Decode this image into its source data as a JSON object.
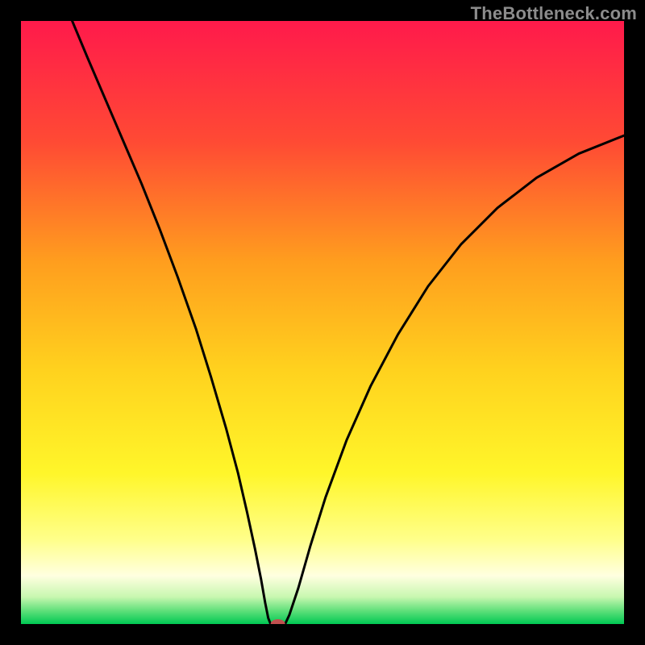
{
  "watermark": "TheBottleneck.com",
  "chart_data": {
    "type": "line",
    "title": "",
    "xlabel": "",
    "ylabel": "",
    "xlim": [
      0,
      1
    ],
    "ylim": [
      0,
      1
    ],
    "background_gradient": {
      "stops": [
        {
          "offset": 0.0,
          "color": "#ff1a4b"
        },
        {
          "offset": 0.2,
          "color": "#ff4a34"
        },
        {
          "offset": 0.4,
          "color": "#ff9e1e"
        },
        {
          "offset": 0.58,
          "color": "#ffd21e"
        },
        {
          "offset": 0.75,
          "color": "#fff62a"
        },
        {
          "offset": 0.86,
          "color": "#ffff8a"
        },
        {
          "offset": 0.92,
          "color": "#ffffe0"
        },
        {
          "offset": 0.955,
          "color": "#c8f7b0"
        },
        {
          "offset": 0.978,
          "color": "#5fe07a"
        },
        {
          "offset": 1.0,
          "color": "#00c853"
        }
      ]
    },
    "curve_points": [
      {
        "x": 0.085,
        "y": 1.0
      },
      {
        "x": 0.11,
        "y": 0.94
      },
      {
        "x": 0.14,
        "y": 0.87
      },
      {
        "x": 0.17,
        "y": 0.8
      },
      {
        "x": 0.2,
        "y": 0.73
      },
      {
        "x": 0.23,
        "y": 0.655
      },
      {
        "x": 0.26,
        "y": 0.575
      },
      {
        "x": 0.29,
        "y": 0.49
      },
      {
        "x": 0.315,
        "y": 0.41
      },
      {
        "x": 0.34,
        "y": 0.325
      },
      {
        "x": 0.36,
        "y": 0.25
      },
      {
        "x": 0.375,
        "y": 0.185
      },
      {
        "x": 0.388,
        "y": 0.125
      },
      {
        "x": 0.398,
        "y": 0.075
      },
      {
        "x": 0.405,
        "y": 0.035
      },
      {
        "x": 0.41,
        "y": 0.01
      },
      {
        "x": 0.414,
        "y": 0.0
      },
      {
        "x": 0.438,
        "y": 0.0
      },
      {
        "x": 0.445,
        "y": 0.015
      },
      {
        "x": 0.46,
        "y": 0.06
      },
      {
        "x": 0.48,
        "y": 0.13
      },
      {
        "x": 0.505,
        "y": 0.21
      },
      {
        "x": 0.54,
        "y": 0.305
      },
      {
        "x": 0.58,
        "y": 0.395
      },
      {
        "x": 0.625,
        "y": 0.48
      },
      {
        "x": 0.675,
        "y": 0.56
      },
      {
        "x": 0.73,
        "y": 0.63
      },
      {
        "x": 0.79,
        "y": 0.69
      },
      {
        "x": 0.855,
        "y": 0.74
      },
      {
        "x": 0.925,
        "y": 0.78
      },
      {
        "x": 1.0,
        "y": 0.81
      }
    ],
    "marker": {
      "x": 0.426,
      "y": 0.0,
      "rx": 0.012,
      "ry": 0.008,
      "color": "#c1504f"
    },
    "curve_color": "#000000",
    "curve_width": 3
  }
}
